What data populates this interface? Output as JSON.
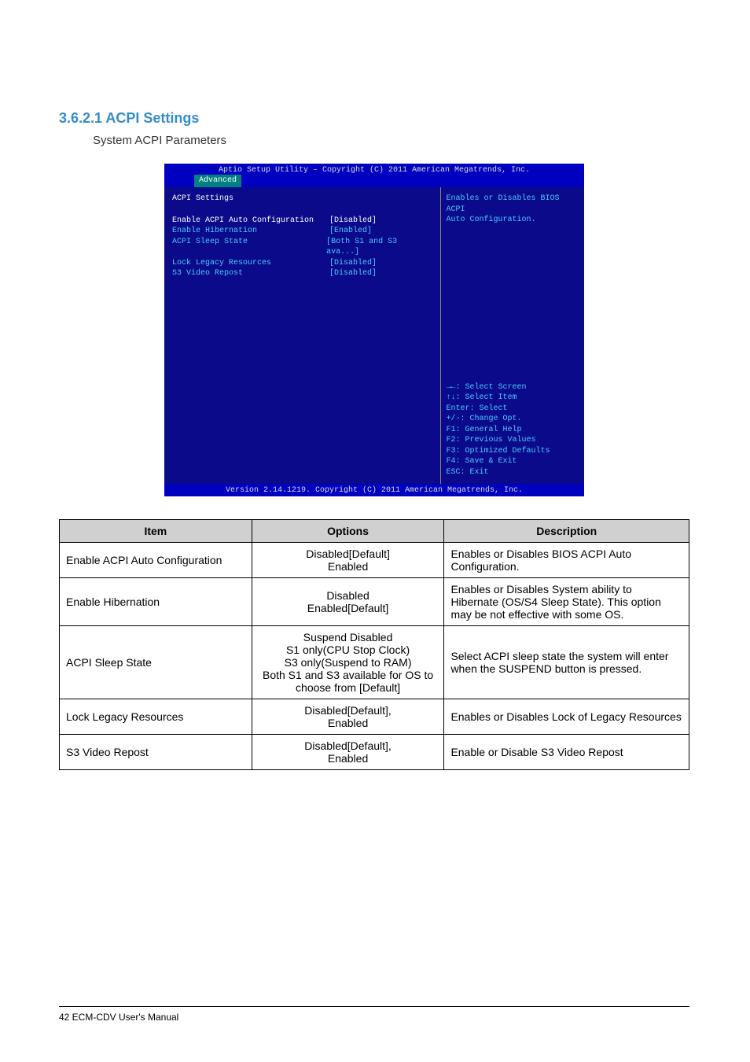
{
  "heading": "3.6.2.1 ACPI Settings",
  "subheading": "System ACPI Parameters",
  "bios": {
    "title": "Aptio Setup Utility – Copyright (C) 2011 American Megatrends, Inc.",
    "tab": "Advanced",
    "section_title": "ACPI Settings",
    "rows": [
      {
        "label": "Enable ACPI Auto Configuration",
        "value": "[Disabled]",
        "highlight": true
      },
      {
        "label": "",
        "value": ""
      },
      {
        "label": "Enable Hibernation",
        "value": "[Enabled]"
      },
      {
        "label": "ACPI Sleep State",
        "value": "[Both S1 and S3 ava...]"
      },
      {
        "label": "Lock Legacy Resources",
        "value": "[Disabled]"
      },
      {
        "label": "S3 Video Repost",
        "value": "[Disabled]"
      }
    ],
    "help_top": [
      "Enables or Disables BIOS ACPI",
      "Auto Configuration."
    ],
    "help_bot": [
      "→←: Select Screen",
      "↑↓: Select Item",
      "Enter: Select",
      "+/-: Change Opt.",
      "F1: General Help",
      "F2: Previous Values",
      "F3: Optimized Defaults",
      "F4: Save & Exit",
      "ESC: Exit"
    ],
    "footer": "Version 2.14.1219. Copyright (C) 2011 American Megatrends, Inc."
  },
  "table": {
    "headers": [
      "Item",
      "Options",
      "Description"
    ],
    "rows": [
      {
        "item": "Enable ACPI Auto Configuration",
        "options": "Disabled[Default]\nEnabled",
        "desc": "Enables or Disables BIOS ACPI Auto Configuration."
      },
      {
        "item": "Enable Hibernation",
        "options": "Disabled\nEnabled[Default]",
        "desc": "Enables or Disables System ability to Hibernate (OS/S4 Sleep State). This option may be not effective with some OS."
      },
      {
        "item": "ACPI Sleep State",
        "options": "Suspend Disabled\nS1 only(CPU Stop Clock)\nS3 only(Suspend to RAM)\nBoth S1 and S3 available for OS to choose from [Default]",
        "desc": "Select ACPI sleep state the system will enter when the SUSPEND button is pressed."
      },
      {
        "item": "Lock Legacy Resources",
        "options": "Disabled[Default],\nEnabled",
        "desc": "Enables or Disables Lock of Legacy Resources"
      },
      {
        "item": "S3 Video Repost",
        "options": "Disabled[Default],\nEnabled",
        "desc": "Enable or Disable S3 Video Repost"
      }
    ]
  },
  "footer_left": "42  ECM-CDV User's Manual",
  "footer_right": ""
}
